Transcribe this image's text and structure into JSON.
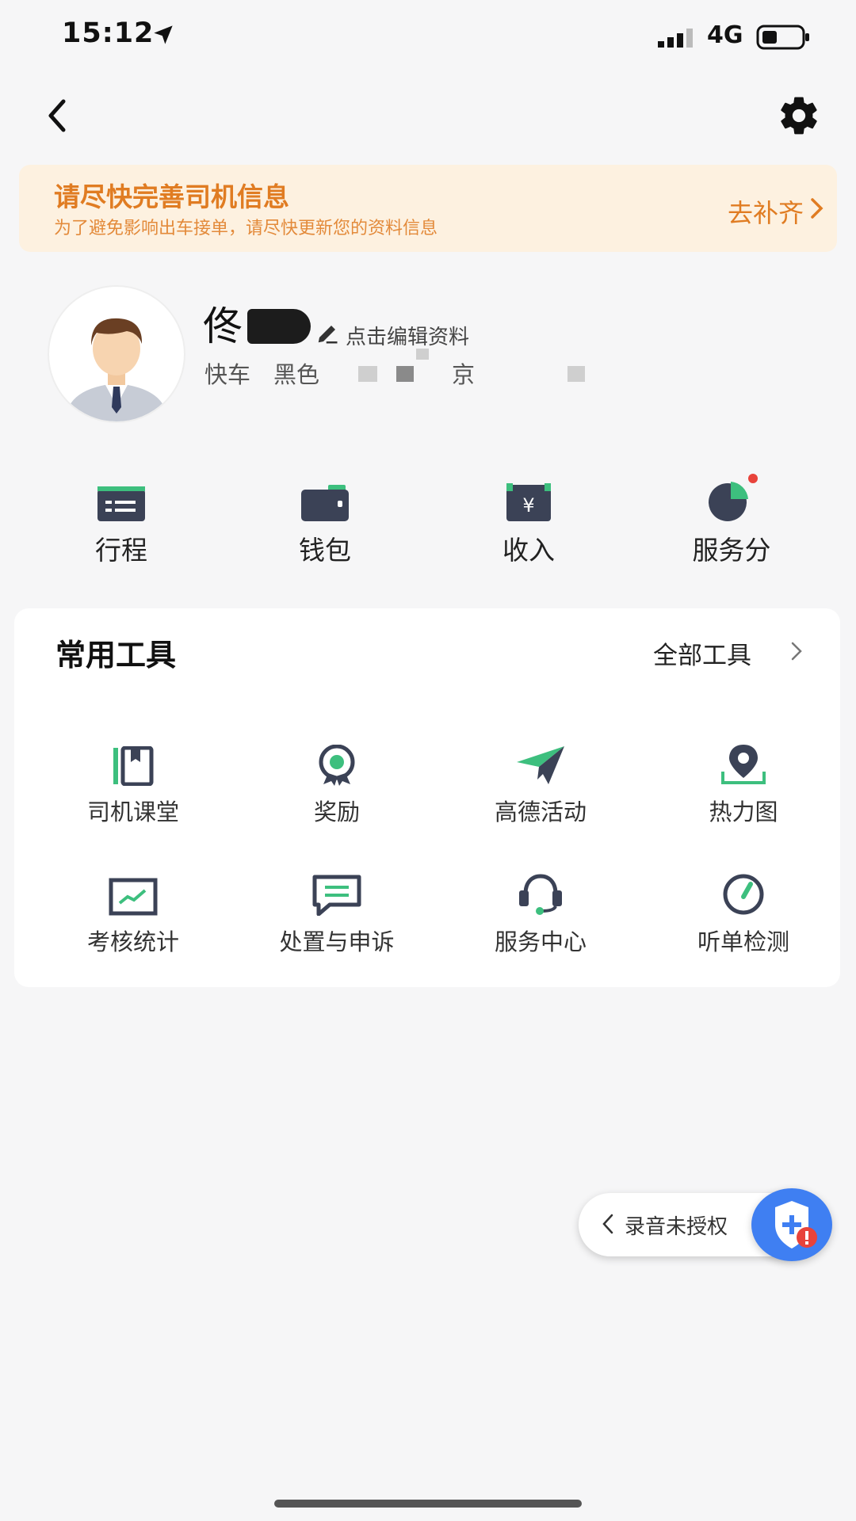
{
  "status_bar": {
    "time": "15:12",
    "network": "4G"
  },
  "banner": {
    "title": "请尽快完善司机信息",
    "subtitle": "为了避免影响出车接单，请尽快更新您的资料信息",
    "action": "去补齐"
  },
  "profile": {
    "name": "佟",
    "edit_link": "点击编辑资料",
    "car_type": "快车",
    "car_color": "黑色",
    "plate_prefix": "京"
  },
  "quick_menu": [
    {
      "label": "行程",
      "icon": "itinerary-icon"
    },
    {
      "label": "钱包",
      "icon": "wallet-icon"
    },
    {
      "label": "收入",
      "icon": "income-icon"
    },
    {
      "label": "服务分",
      "icon": "service-score-icon"
    }
  ],
  "tools": {
    "title": "常用工具",
    "all_link": "全部工具",
    "items": [
      {
        "label": "司机课堂",
        "icon": "book-icon"
      },
      {
        "label": "奖励",
        "icon": "reward-icon"
      },
      {
        "label": "高德活动",
        "icon": "paper-plane-icon"
      },
      {
        "label": "热力图",
        "icon": "map-pin-icon"
      },
      {
        "label": "考核统计",
        "icon": "chart-icon"
      },
      {
        "label": "处置与申诉",
        "icon": "message-icon"
      },
      {
        "label": "服务中心",
        "icon": "headset-icon"
      },
      {
        "label": "听单检测",
        "icon": "gauge-icon"
      }
    ]
  },
  "floating": {
    "record_label": "录音未授权"
  },
  "colors": {
    "accent_green": "#3dbf7e",
    "icon_dark": "#3b4256",
    "banner_orange": "#e07c22",
    "badge_red": "#e8433b",
    "shield_blue": "#3f7ff2"
  }
}
